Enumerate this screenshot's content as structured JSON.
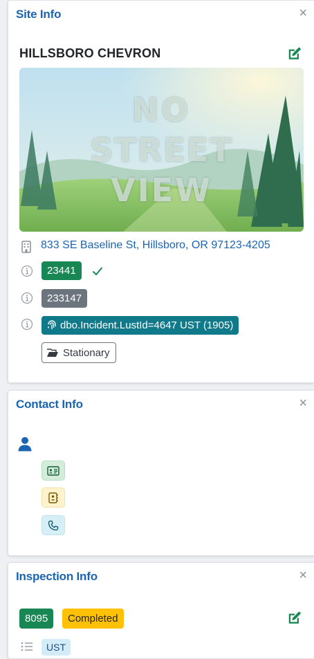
{
  "site_info": {
    "title": "Site Info",
    "close_glyph": "×",
    "site_name": "HILLSBORO CHEVRON",
    "street_view": {
      "line1": "NO",
      "line2": "STREET",
      "line3": "VIEW"
    },
    "address": "833 SE Baseline St, Hillsboro, OR 97123-4205",
    "id_green": "23441",
    "id_gray": "233147",
    "lust_badge": "dbo.Incident.LustId=4647 UST (1905)",
    "stationary_label": "Stationary"
  },
  "contact_info": {
    "title": "Contact Info",
    "close_glyph": "×"
  },
  "inspection_info": {
    "title": "Inspection Info",
    "close_glyph": "×",
    "inspection_id": "8095",
    "status": "Completed",
    "type_tag": "UST"
  },
  "colors": {
    "accent_blue": "#1b64b2",
    "success_green": "#198754",
    "secondary_gray": "#6c757d",
    "teal": "#107a8a",
    "warning_yellow": "#ffc107"
  },
  "icons": [
    "close-icon",
    "edit-icon",
    "building-icon",
    "info-icon",
    "check-icon",
    "fingerprint-icon",
    "folder-open-icon",
    "person-icon",
    "id-card-icon",
    "contact-book-icon",
    "phone-icon",
    "list-icon"
  ]
}
